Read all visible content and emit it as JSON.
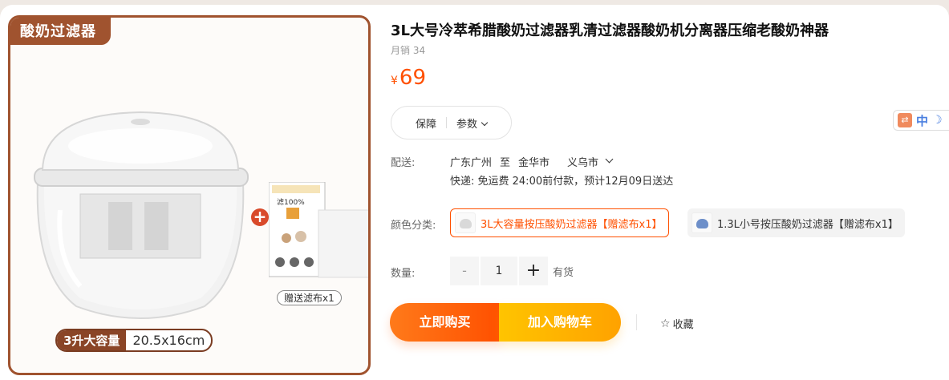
{
  "image": {
    "tag": "酸奶过滤器",
    "gift_label": "赠送滤布x1",
    "capacity_badge": "3升大容量",
    "size_badge": "20.5x16cm",
    "plus_sign": "+",
    "cloth_pack_text": "滤100%"
  },
  "product": {
    "title": "3L大号冷萃希腊酸奶过滤器乳清过滤器酸奶机分离器压缩老酸奶神器",
    "monthly_sales": "月销 34",
    "currency": "¥",
    "price": "69"
  },
  "tabs": [
    {
      "label": "保障"
    },
    {
      "label": "参数"
    }
  ],
  "lang_widget": {
    "zh": "中",
    "moon": "☽"
  },
  "shipping": {
    "label": "配送:",
    "from": "广东广州",
    "to_word": "至",
    "to_city": "金华市",
    "to_district": "义乌市",
    "info": "快递: 免运费  24:00前付款，预计12月09日送达"
  },
  "color": {
    "label": "颜色分类:",
    "options": [
      {
        "label": "3L大容量按压酸奶过滤器【赠滤布x1】",
        "selected": true
      },
      {
        "label": "1.3L小号按压酸奶过滤器【赠滤布x1】",
        "selected": false
      }
    ]
  },
  "quantity": {
    "label": "数量:",
    "minus": "-",
    "value": "1",
    "plus": "+",
    "stock": "有货"
  },
  "actions": {
    "buy": "立即购买",
    "cart": "加入购物车",
    "favorite": "收藏",
    "favorite_icon": "☆"
  },
  "colors": {
    "accent": "#ff5000",
    "cart_yellow": "#ffa200",
    "brand_brown": "#a0532f"
  }
}
